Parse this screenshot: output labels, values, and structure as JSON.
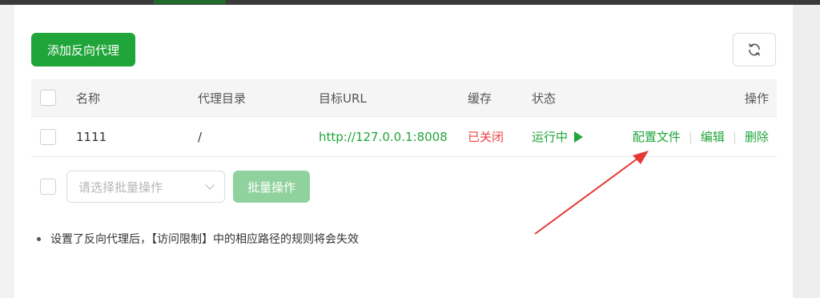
{
  "toolbar": {
    "add_label": "添加反向代理",
    "refresh_icon": "refresh-icon"
  },
  "table": {
    "headers": {
      "name": "名称",
      "dir": "代理目录",
      "url": "目标URL",
      "cache": "缓存",
      "status": "状态",
      "ops": "操作"
    },
    "rows": [
      {
        "name": "1111",
        "dir": "/",
        "url": "http://127.0.0.1:8008",
        "cache": "已关闭",
        "status": "运行中",
        "op_config": "配置文件",
        "op_edit": "编辑",
        "op_delete": "删除"
      }
    ]
  },
  "batch": {
    "select_placeholder": "请选择批量操作",
    "button_label": "批量操作"
  },
  "tip": "设置了反向代理后，【访问限制】中的相应路径的规则将会失效",
  "colors": {
    "primary": "#20a53a",
    "danger": "#ef3f3f",
    "annotation": "#e53935"
  }
}
